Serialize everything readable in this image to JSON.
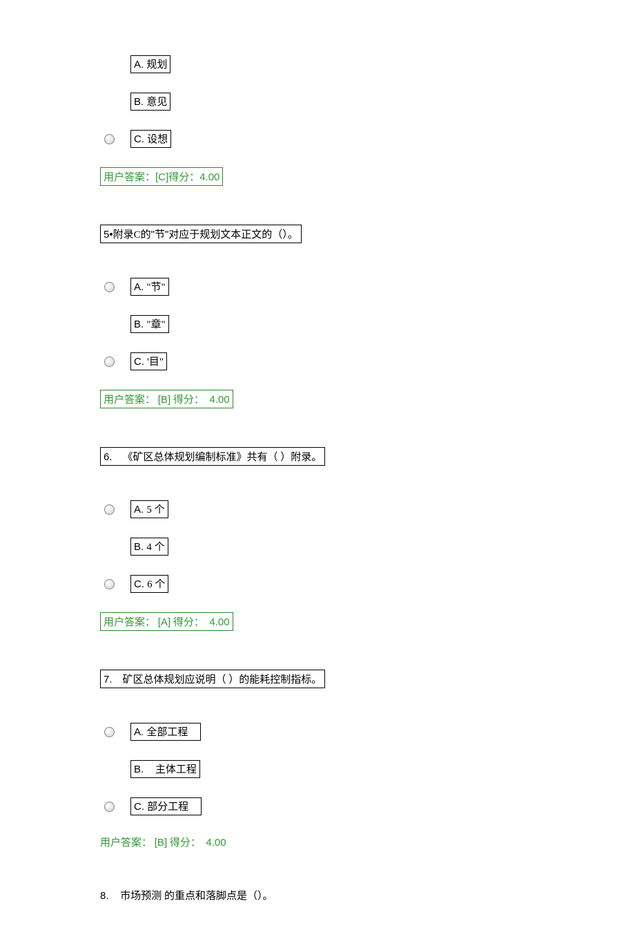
{
  "q4": {
    "options": {
      "a": {
        "letter": "A.",
        "text": "规划"
      },
      "b": {
        "letter": "B.",
        "text": "意见"
      },
      "c": {
        "letter": "C.",
        "text": "设想"
      }
    },
    "answer_prefix": "用户答案：",
    "answer_code": "[C]",
    "answer_score_label": "得分：",
    "answer_score": "4.00"
  },
  "q5": {
    "number": "5•",
    "text_prefix": "附录C的",
    "text_quote1": "\"",
    "text_quote_content": "节",
    "text_quote2": "\"",
    "text_suffix": "对应于规划文本正文的（）。",
    "options": {
      "a": {
        "letter": "A.",
        "text": "\"节\""
      },
      "b": {
        "letter": "B.",
        "text": "\"章\""
      },
      "c": {
        "letter": "C.",
        "text": "'目\""
      }
    },
    "answer_prefix": "用户答案：",
    "answer_code": "[B]",
    "answer_score_label": "得分：",
    "answer_score": "4.00"
  },
  "q6": {
    "number": "6.",
    "text": "《矿区总体规划编制标准》共有（ ）附录。",
    "options": {
      "a": {
        "letter": "A.",
        "text": "5 个"
      },
      "b": {
        "letter": "B.",
        "text": "4 个"
      },
      "c": {
        "letter": "C.",
        "text": "6 个"
      }
    },
    "answer_prefix": "用户答案：",
    "answer_code": "[A]",
    "answer_score_label": "得分：",
    "answer_score": "4.00"
  },
  "q7": {
    "number": "7.",
    "text": "矿区总体规划应说明（ ）的能耗控制指标。",
    "options": {
      "a": {
        "letter": "A.",
        "text": "全部工程"
      },
      "b": {
        "letter": "B.",
        "text": "主体工程"
      },
      "c": {
        "letter": "C.",
        "text": "部分工程"
      }
    },
    "answer_prefix": "用户答案：",
    "answer_code": "[B]",
    "answer_score_label": "得分：",
    "answer_score": "4.00"
  },
  "q8": {
    "number": "8.",
    "text": "市场预测 的重点和落脚点是（）。"
  }
}
